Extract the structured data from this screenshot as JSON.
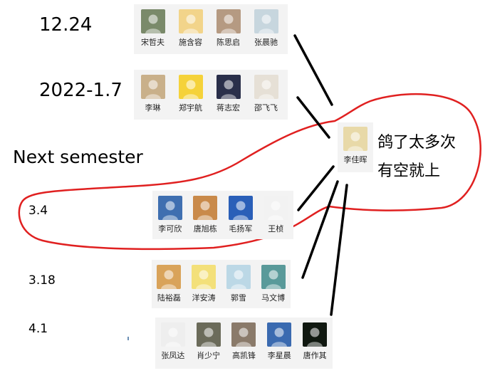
{
  "labels": {
    "date_1224": "12.24",
    "date_2022_17": "2022-1.7",
    "next_semester": "Next semester",
    "date_34": "3.4",
    "date_318": "3.18",
    "date_41": "4.1"
  },
  "groups": {
    "g1224": [
      {
        "name": "宋哲夫",
        "avatar": "portrait-man-icon",
        "color": "#7a8a6a"
      },
      {
        "name": "施含容",
        "avatar": "cartoon-kid-icon",
        "color": "#f2d48a"
      },
      {
        "name": "陈思启",
        "avatar": "cat-icon",
        "color": "#b59a82"
      },
      {
        "name": "张晨驰",
        "avatar": "building-icon",
        "color": "#c7d6de"
      }
    ],
    "g2022": [
      {
        "name": "李琳",
        "avatar": "cartoon-boy-icon",
        "color": "#c9b08a"
      },
      {
        "name": "郑宇航",
        "avatar": "pikachu-icon",
        "color": "#f5d23a"
      },
      {
        "name": "蒋志宏",
        "avatar": "ghost-icon",
        "color": "#2a2f4a"
      },
      {
        "name": "邵飞飞",
        "avatar": "sketch-face-icon",
        "color": "#e6e0d6"
      }
    ],
    "g34": [
      {
        "name": "李可欣",
        "avatar": "sky-figure-icon",
        "color": "#3f6fb0"
      },
      {
        "name": "唐旭栋",
        "avatar": "warm-portrait-icon",
        "color": "#c98a4a"
      },
      {
        "name": "毛扬军",
        "avatar": "ponyo-icon",
        "color": "#2a5fb8"
      },
      {
        "name": "王桢",
        "avatar": "doodle-face-icon",
        "color": "#f2f2f2"
      }
    ],
    "g318": [
      {
        "name": "陆裕磊",
        "avatar": "dog-hat-icon",
        "color": "#d9a35a"
      },
      {
        "name": "洋安涛",
        "avatar": "minion-icon",
        "color": "#f3e07a"
      },
      {
        "name": "郭雪",
        "avatar": "beach-icon",
        "color": "#bcd8e6"
      },
      {
        "name": "马文博",
        "avatar": "anime-girl-icon",
        "color": "#5a9a9a"
      }
    ],
    "g41": [
      {
        "name": "张凤达",
        "avatar": "boy-sketch-icon",
        "color": "#eeeeee"
      },
      {
        "name": "肖少宁",
        "avatar": "runner-icon",
        "color": "#6b6b5a"
      },
      {
        "name": "高凯锋",
        "avatar": "fox-icon",
        "color": "#8a7a6a"
      },
      {
        "name": "李星晨",
        "avatar": "cartoon-face-icon",
        "color": "#3a6ab0"
      },
      {
        "name": "唐作其",
        "avatar": "night-light-icon",
        "color": "#101810"
      }
    ]
  },
  "center": {
    "name": "李佳晖",
    "avatar": "green-dino-icon",
    "color": "#e8d9a8"
  },
  "note": {
    "line1": "鸽了太多次",
    "line2": "有空就上"
  },
  "colors": {
    "red_outline": "#e02020",
    "connector": "#000000"
  }
}
